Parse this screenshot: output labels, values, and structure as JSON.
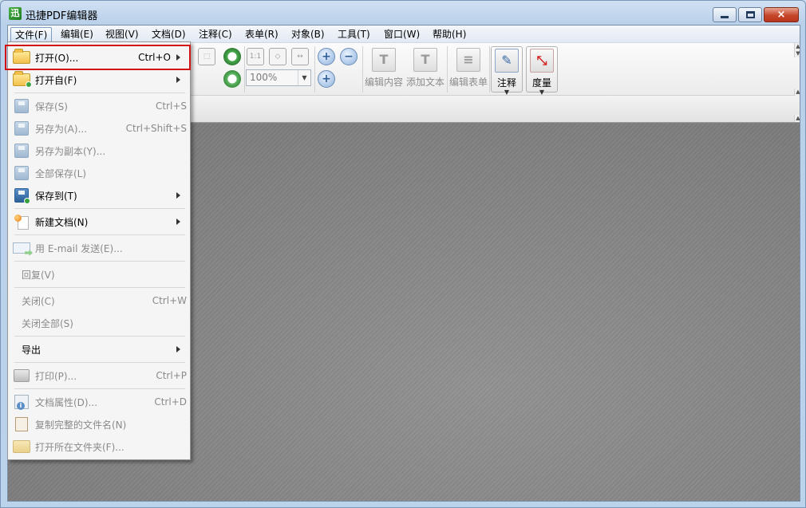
{
  "window": {
    "title": "迅捷PDF编辑器",
    "app_icon_glyph": "迅",
    "buttons": {
      "minimize": "minimize-icon",
      "maximize": "maximize-icon",
      "close": "×"
    }
  },
  "menubar": [
    {
      "id": "file",
      "label": "文件(F)",
      "active": true
    },
    {
      "id": "edit",
      "label": "编辑(E)"
    },
    {
      "id": "view",
      "label": "视图(V)"
    },
    {
      "id": "document",
      "label": "文档(D)"
    },
    {
      "id": "comment",
      "label": "注释(C)"
    },
    {
      "id": "form",
      "label": "表单(R)"
    },
    {
      "id": "object",
      "label": "对象(B)"
    },
    {
      "id": "tools",
      "label": "工具(T)"
    },
    {
      "id": "window",
      "label": "窗口(W)"
    },
    {
      "id": "help",
      "label": "帮助(H)"
    }
  ],
  "toolbar": {
    "zoom_value": "100%",
    "page_fit_label": "1:1",
    "edit_content": "编辑内容",
    "add_text": "添加文本",
    "edit_form": "编辑表单",
    "annotate": "注释",
    "measure": "度量",
    "dropdown_arrow": "▼"
  },
  "file_menu": {
    "items": [
      {
        "label": "打开(O)...",
        "shortcut": "Ctrl+O",
        "icon": "folder-open-icon",
        "submenu": true,
        "enabled": true
      },
      {
        "label": "打开自(F)",
        "shortcut": "",
        "icon": "folder-cloud-icon",
        "submenu": true,
        "enabled": true
      },
      {
        "label": "保存(S)",
        "shortcut": "Ctrl+S",
        "icon": "save-icon",
        "enabled": false
      },
      {
        "label": "另存为(A)...",
        "shortcut": "Ctrl+Shift+S",
        "icon": "save-as-icon",
        "enabled": false
      },
      {
        "label": "另存为副本(Y)...",
        "shortcut": "",
        "icon": "save-copy-icon",
        "enabled": false
      },
      {
        "label": "全部保存(L)",
        "shortcut": "",
        "icon": "save-all-icon",
        "enabled": false
      },
      {
        "label": "保存到(T)",
        "shortcut": "",
        "icon": "save-to-icon",
        "submenu": true,
        "enabled": true
      },
      {
        "label": "新建文档(N)",
        "shortcut": "",
        "icon": "new-document-icon",
        "submenu": true,
        "enabled": true
      },
      {
        "label": "用 E-mail 发送(E)...",
        "shortcut": "",
        "icon": "email-icon",
        "enabled": false
      },
      {
        "label": "回复(V)",
        "shortcut": "",
        "enabled": false
      },
      {
        "label": "关闭(C)",
        "shortcut": "Ctrl+W",
        "enabled": false
      },
      {
        "label": "关闭全部(S)",
        "shortcut": "",
        "enabled": false
      },
      {
        "label": "导出",
        "shortcut": "",
        "submenu": true,
        "enabled": true
      },
      {
        "label": "打印(P)...",
        "shortcut": "Ctrl+P",
        "icon": "printer-icon",
        "enabled": false
      },
      {
        "label": "文档属性(D)...",
        "shortcut": "Ctrl+D",
        "icon": "document-properties-icon",
        "enabled": false
      },
      {
        "label": "复制完整的文件名(N)",
        "shortcut": "",
        "icon": "copy-filename-icon",
        "enabled": false
      },
      {
        "label": "打开所在文件夹(F)...",
        "shortcut": "",
        "icon": "open-containing-folder-icon",
        "enabled": false
      }
    ]
  },
  "colors": {
    "highlight_border": "#d31212",
    "menu_bg": "#f5f5f5",
    "canvas_bg": "#8a8a8a"
  }
}
